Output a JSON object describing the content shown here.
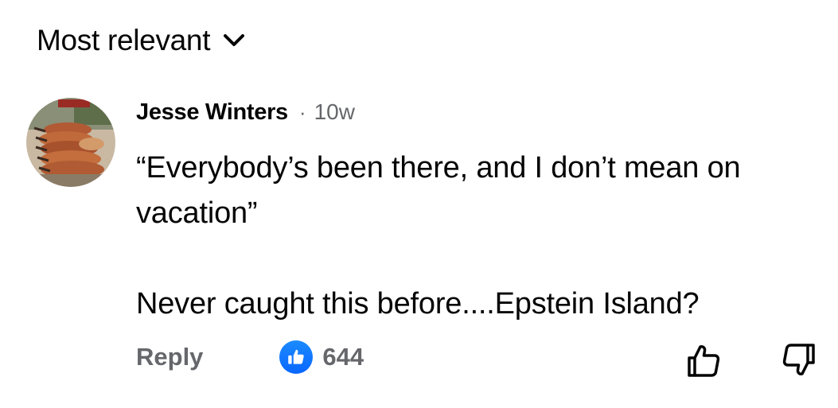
{
  "sort": {
    "label": "Most relevant",
    "icon": "chevron-down-icon"
  },
  "comment": {
    "author": "Jesse Winters",
    "separator": "·",
    "time": "10w",
    "avatar_icon": "profile-photo",
    "body": [
      "“Everybody’s been there, and I don’t mean on vacation”",
      "Never caught this before....Epstein Island?"
    ],
    "actions": {
      "reply_label": "Reply",
      "like_count": "644",
      "like_icon": "like-thumb-icon",
      "upvote_icon": "thumbs-up-outline-icon",
      "downvote_icon": "thumbs-down-outline-icon"
    }
  },
  "colors": {
    "text_primary": "#050505",
    "text_secondary": "#65676b",
    "like_blue": "#0866ff"
  }
}
